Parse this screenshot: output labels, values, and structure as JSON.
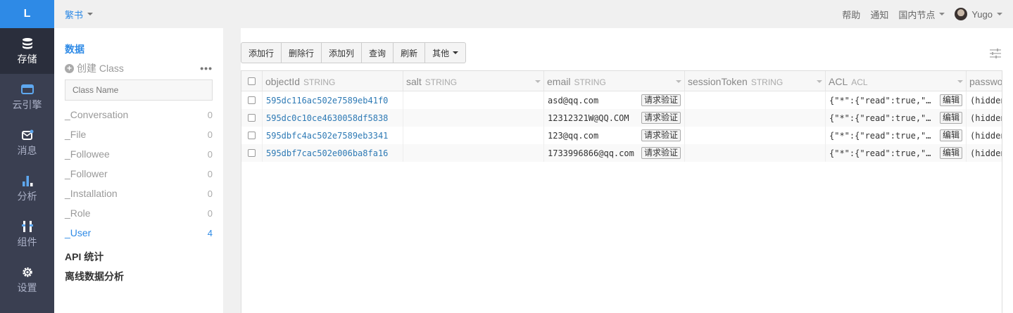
{
  "nav": {
    "logo": "L",
    "items": [
      {
        "label": "存储",
        "icon": "database-icon",
        "active": true
      },
      {
        "label": "云引擎",
        "icon": "cloud-engine-icon",
        "active": false
      },
      {
        "label": "消息",
        "icon": "message-icon",
        "active": false
      },
      {
        "label": "分析",
        "icon": "bar-chart-icon",
        "active": false
      },
      {
        "label": "组件",
        "icon": "components-icon",
        "active": false
      },
      {
        "label": "设置",
        "icon": "gear-icon",
        "active": false
      }
    ]
  },
  "topbar": {
    "app_name": "繁书",
    "help": "帮助",
    "notify": "通知",
    "region": "国内节点",
    "user": "Yugo"
  },
  "sidebar": {
    "section_title": "数据",
    "create_class": "创建 Class",
    "more": "•••",
    "class_name_placeholder": "Class Name",
    "classes": [
      {
        "name": "_Conversation",
        "count": "0"
      },
      {
        "name": "_File",
        "count": "0"
      },
      {
        "name": "_Followee",
        "count": "0"
      },
      {
        "name": "_Follower",
        "count": "0"
      },
      {
        "name": "_Installation",
        "count": "0"
      },
      {
        "name": "_Role",
        "count": "0"
      },
      {
        "name": "_User",
        "count": "4",
        "active": true
      }
    ],
    "api_stats": "API 统计",
    "offline_analysis": "离线数据分析"
  },
  "toolbar": {
    "add_row": "添加行",
    "delete_row": "删除行",
    "add_column": "添加列",
    "query": "查询",
    "refresh": "刷新",
    "more": "其他"
  },
  "table": {
    "columns": [
      {
        "name": "objectId",
        "type": "STRING"
      },
      {
        "name": "salt",
        "type": "STRING"
      },
      {
        "name": "email",
        "type": "STRING"
      },
      {
        "name": "sessionToken",
        "type": "STRING"
      },
      {
        "name": "ACL",
        "type": "ACL"
      },
      {
        "name": "passwo",
        "type": ""
      }
    ],
    "verify_label": "请求验证",
    "edit_label": "编辑",
    "rows": [
      {
        "objectId": "595dc116ac502e7589eb41f0",
        "salt": "",
        "email": "asd@qq.com",
        "sessionToken": "",
        "acl": "{\"*\":{\"read\":true,\"w…",
        "password": "(hidden)"
      },
      {
        "objectId": "595dc0c10ce4630058df5838",
        "salt": "",
        "email": "12312321W@QQ.COM",
        "sessionToken": "",
        "acl": "{\"*\":{\"read\":true,\"w…",
        "password": "(hidden)"
      },
      {
        "objectId": "595dbfc4ac502e7589eb3341",
        "salt": "",
        "email": "123@qq.com",
        "sessionToken": "",
        "acl": "{\"*\":{\"read\":true,\"w…",
        "password": "(hidden)"
      },
      {
        "objectId": "595dbf7cac502e006ba8fa16",
        "salt": "",
        "email": "1733996866@qq.com",
        "sessionToken": "",
        "acl": "{\"*\":{\"read\":true,\"w…",
        "password": "(hidden)"
      }
    ]
  },
  "colors": {
    "accent": "#2e8ae6",
    "nav_bg": "#3a3f51",
    "nav_active": "#2a2e3c",
    "link": "#2e7ab5"
  }
}
